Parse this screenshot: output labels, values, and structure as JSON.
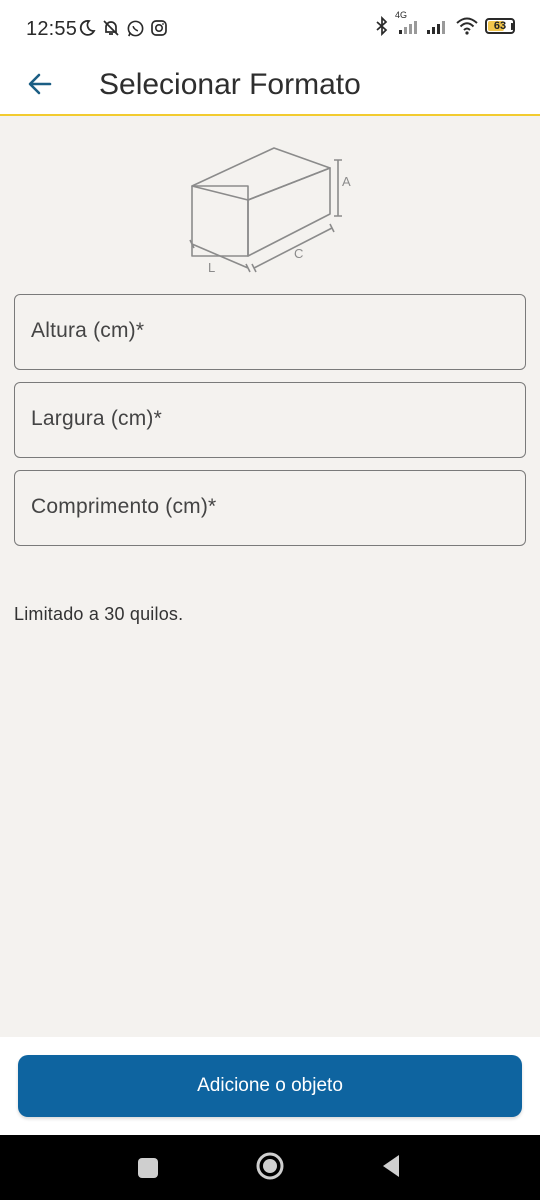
{
  "status_bar": {
    "time": "12:55",
    "network_label": "4G",
    "battery_level": "63",
    "left_icons": [
      "moon-icon",
      "bell-off-icon",
      "whatsapp-icon",
      "instagram-icon"
    ],
    "right_icons": [
      "bluetooth-icon",
      "signal-4g-icon",
      "signal-icon",
      "wifi-icon",
      "battery-icon"
    ]
  },
  "app_bar": {
    "title": "Selecionar Formato",
    "back_icon": "arrow-left-icon",
    "accent_color": "#f2cb2f"
  },
  "illustration": {
    "icon": "box-dimensions-icon",
    "labels": {
      "height": "A",
      "width": "L",
      "length": "C"
    }
  },
  "form": {
    "fields": [
      {
        "label": "Altura (cm)*",
        "value": ""
      },
      {
        "label": "Largura (cm)*",
        "value": ""
      },
      {
        "label": "Comprimento (cm)*",
        "value": ""
      }
    ],
    "note": "Limitado a 30 quilos."
  },
  "actions": {
    "submit_label": "Adicione o objeto",
    "button_color": "#0e64a0"
  },
  "nav_bar": {
    "buttons": [
      "recent-apps-icon",
      "home-icon",
      "back-triangle-icon"
    ]
  }
}
